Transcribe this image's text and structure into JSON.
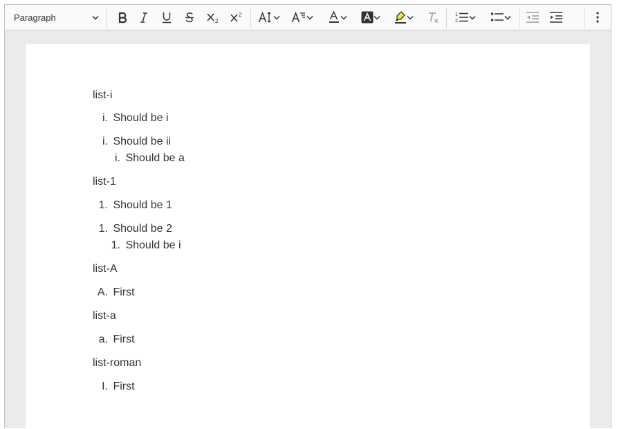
{
  "toolbar": {
    "heading_select": "Paragraph"
  },
  "document": {
    "blocks": [
      {
        "label": "list-i"
      },
      {
        "marker": "i.",
        "text": "Should be i"
      },
      {
        "marker": "i.",
        "text": "Should be ii"
      },
      {
        "marker": "i.",
        "text": "Should be a"
      },
      {
        "label": "list-1"
      },
      {
        "marker": "1.",
        "text": "Should be 1"
      },
      {
        "marker": "1.",
        "text": "Should be 2"
      },
      {
        "marker": "1.",
        "text": "Should be i"
      },
      {
        "label": "list-A"
      },
      {
        "marker": "A.",
        "text": "First"
      },
      {
        "label": "list-a"
      },
      {
        "marker": "a.",
        "text": "First"
      },
      {
        "label": "list-roman"
      },
      {
        "marker": "I.",
        "text": "First"
      }
    ]
  },
  "colors": {
    "toolbar_bg": "#fafafa",
    "editor_bg": "#ebebeb",
    "page_bg": "#ffffff",
    "text": "#333333",
    "highlight_yellow": "#f5e23a"
  }
}
